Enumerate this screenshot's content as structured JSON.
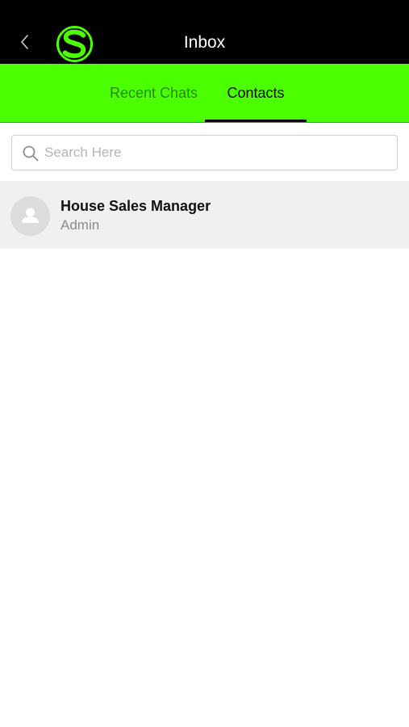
{
  "header": {
    "back_icon": "chevron-left-icon",
    "logo_icon": "s-logo-icon",
    "title": "Inbox"
  },
  "tabs": [
    {
      "label": "Recent Chats",
      "active": false
    },
    {
      "label": "Contacts",
      "active": true
    }
  ],
  "search": {
    "placeholder": "Search Here",
    "value": "",
    "icon": "search-icon"
  },
  "contacts": [
    {
      "name": "House Sales Manager",
      "role": "Admin",
      "avatar_icon": "person-icon"
    }
  ],
  "colors": {
    "header_bg": "#000000",
    "accent": "#4cff00",
    "tab_inactive_text": "#2a8a10",
    "tab_active_text": "#0a0a0a",
    "row_bg": "#f0f0f0"
  }
}
